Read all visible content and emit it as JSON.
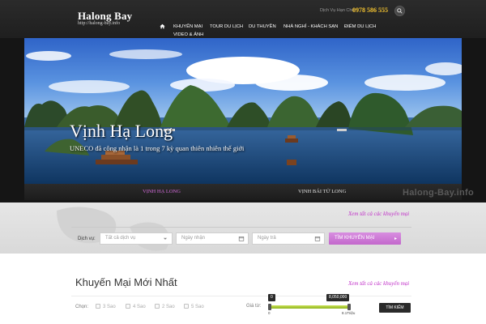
{
  "header": {
    "logo_title": "Halong Bay",
    "logo_subtitle": "http://halong-bay.info",
    "hotline_label": "Dịch Vụ Hạn Chế:",
    "hotline_number": "0978 586 555",
    "search_icon": "search-icon"
  },
  "nav": {
    "home_icon": "home-icon",
    "items": [
      {
        "label": "KHUYẾN MẠI"
      },
      {
        "label": "TOUR DU LỊCH"
      },
      {
        "label": "DU THUYỀN"
      },
      {
        "label": "NHÀ NGHỈ - KHÁCH SẠN"
      },
      {
        "label": "ĐIỂM DU LỊCH"
      },
      {
        "label": "VIDEO & ẢNH"
      }
    ]
  },
  "slider": {
    "title": "Vịnh Hạ Long",
    "caption": "UNECO đã công nhận là 1 trong 7 kỳ quan thiên nhiên thế giới",
    "tabs": [
      {
        "label": "VỊNH HẠ LONG",
        "active": true
      },
      {
        "label": "VỊNH BÁI TỬ LONG",
        "active": false
      }
    ],
    "watermark": "Halong-Bay.info"
  },
  "search": {
    "see_all": "Xem tất cả các khuyến mại",
    "service_label": "Dịch vụ:",
    "service_value": "Tất cả dịch vụ",
    "checkin_placeholder": "Ngày nhận",
    "checkout_placeholder": "Ngày trả",
    "button_label": "TÌM KHUYẾN MẠI",
    "calendar_icon": "calendar-icon",
    "dropdown_icon": "chevron-down-icon"
  },
  "promotions": {
    "title": "Khuyến Mại Mới Nhất",
    "see_all": "Xem tất cả các khuyến mại",
    "choose_label": "Chọn:",
    "star_options": [
      {
        "label": "3 Sao"
      },
      {
        "label": "4 Sao"
      },
      {
        "label": "2 Sao"
      },
      {
        "label": "5 Sao"
      }
    ],
    "price_label": "Giá từ:",
    "price_min_tip": "0",
    "price_max_tip": "8,050,000",
    "price_min_under": "0",
    "price_max_under": "8.1Triệu",
    "price_selected_fraction": 1.0,
    "search_button": "TÌM KIẾM"
  },
  "colors": {
    "accent": "#c367cc",
    "link": "#c030c8",
    "hotline": "#f2c230",
    "slider_fill": "#a4c53a"
  }
}
